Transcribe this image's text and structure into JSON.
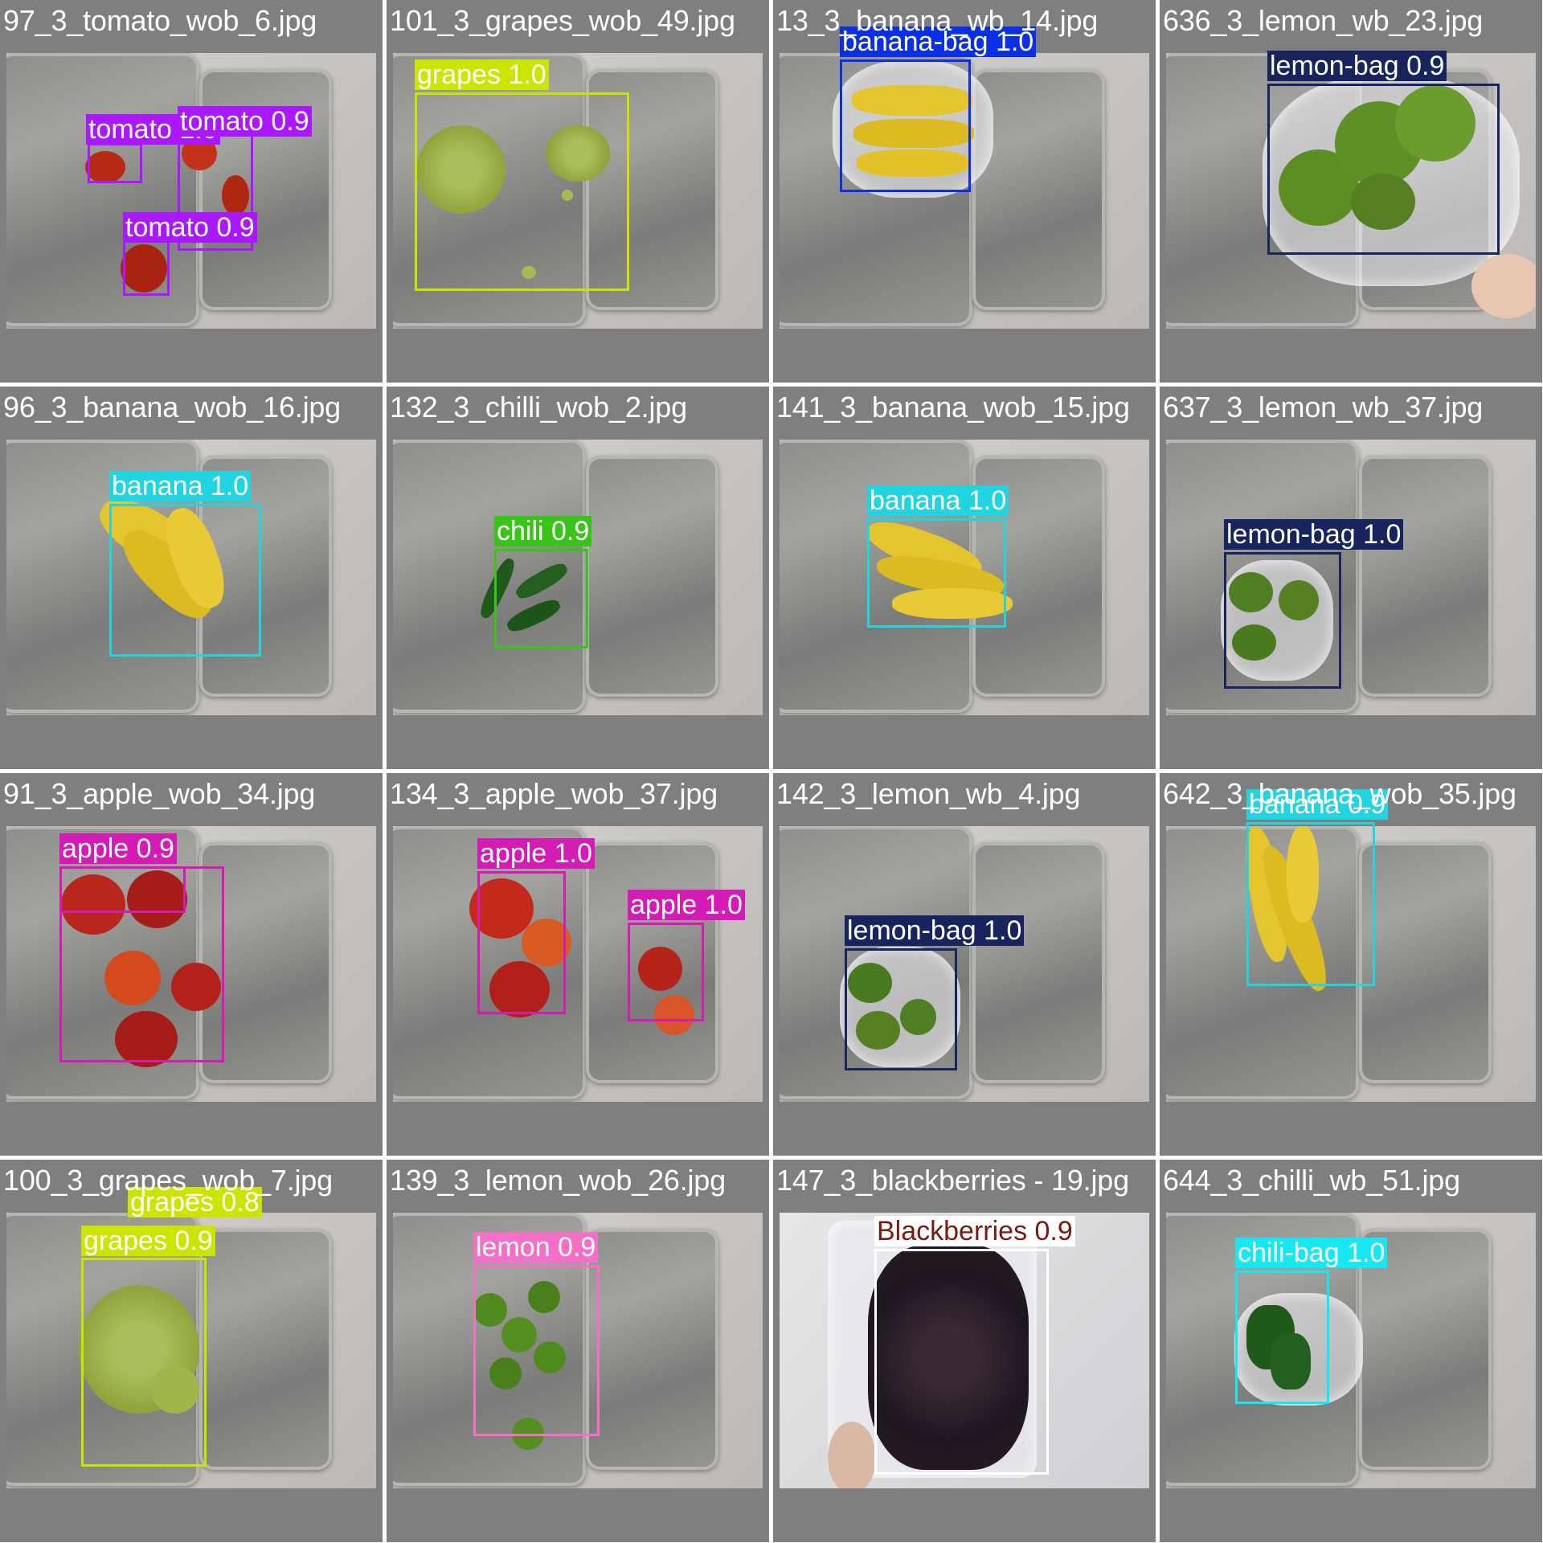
{
  "tiles": [
    {
      "filename": "97_3_tomato_wob_6.jpg",
      "detections": [
        {
          "label": "tomato 1.0"
        },
        {
          "label": "tomato 0.9"
        },
        {
          "label": "tomato 0.9"
        }
      ]
    },
    {
      "filename": "101_3_grapes_wob_49.jpg",
      "detections": [
        {
          "label": "grapes 1.0"
        }
      ]
    },
    {
      "filename": "13_3_banana_wb_14.jpg",
      "detections": [
        {
          "label": "banana-bag 1.0"
        }
      ]
    },
    {
      "filename": "636_3_lemon_wb_23.jpg",
      "detections": [
        {
          "label": "lemon-bag 0.9"
        }
      ]
    },
    {
      "filename": "96_3_banana_wob_16.jpg",
      "detections": [
        {
          "label": "banana 1.0"
        }
      ]
    },
    {
      "filename": "132_3_chilli_wob_2.jpg",
      "detections": [
        {
          "label": "chili 0.9"
        }
      ]
    },
    {
      "filename": "141_3_banana_wob_15.jpg",
      "detections": [
        {
          "label": "banana 1.0"
        }
      ]
    },
    {
      "filename": "637_3_lemon_wb_37.jpg",
      "detections": [
        {
          "label": "lemon-bag 1.0"
        }
      ]
    },
    {
      "filename": "91_3_apple_wob_34.jpg",
      "detections": [
        {
          "label": "apple 0.9"
        }
      ]
    },
    {
      "filename": "134_3_apple_wob_37.jpg",
      "detections": [
        {
          "label": "apple 1.0"
        },
        {
          "label": "apple 1.0"
        }
      ]
    },
    {
      "filename": "142_3_lemon_wb_4.jpg",
      "detections": [
        {
          "label": "lemon-bag 1.0"
        }
      ]
    },
    {
      "filename": "642_3_banana_wob_35.jpg",
      "detections": [
        {
          "label": "banana 0.9"
        }
      ]
    },
    {
      "filename": "100_3_grapes_wob_7.jpg",
      "detections": [
        {
          "label": "grapes 0.8"
        },
        {
          "label": "grapes 0.9"
        }
      ]
    },
    {
      "filename": "139_3_lemon_wob_26.jpg",
      "detections": [
        {
          "label": "lemon 0.9"
        }
      ]
    },
    {
      "filename": "147_3_blackberries - 19.jpg",
      "detections": [
        {
          "label": "Blackberries 0.9"
        }
      ]
    },
    {
      "filename": "644_3_chilli_wb_51.jpg",
      "detections": [
        {
          "label": "chili-bag 1.0"
        }
      ]
    }
  ],
  "colors": {
    "tomato": "#a918ff",
    "grapes": "#cce500",
    "banana_bag": "#0a2fe6",
    "lemon_bag": "#17245e",
    "banana": "#22d4e0",
    "chili": "#3ac31a",
    "apple": "#d61ab5",
    "lemon": "#f56fc8",
    "blackberries": "#ffffff",
    "chili_bag": "#16e8f2",
    "tile_background": "#7f7f7f"
  }
}
